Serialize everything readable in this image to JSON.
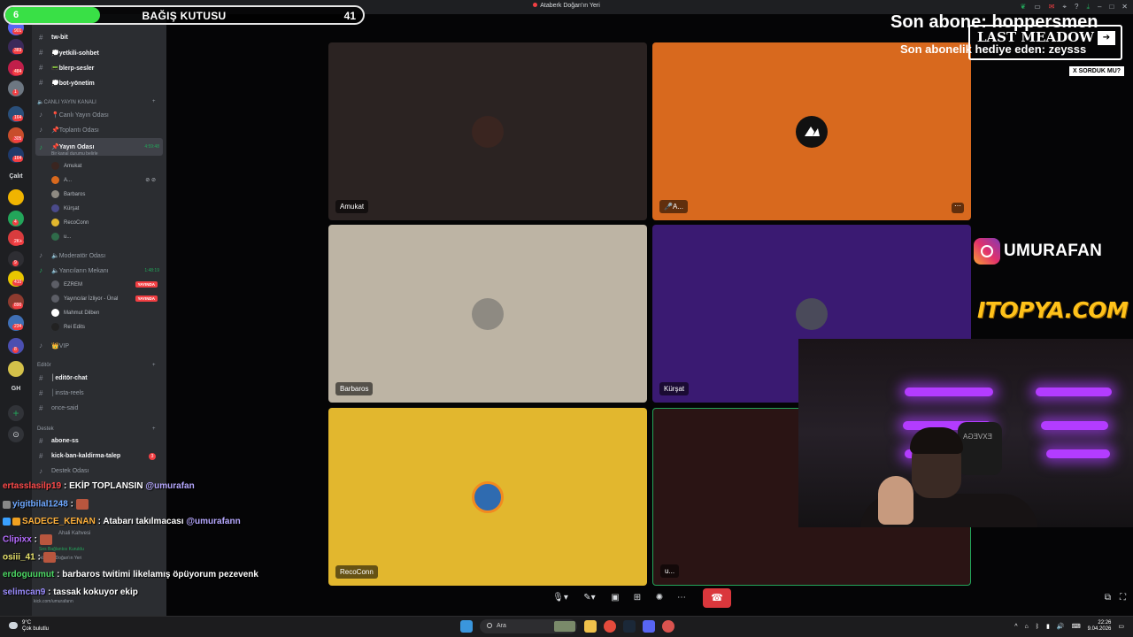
{
  "window": {
    "title": "Ataberk Doğan'ın Yeri",
    "server_header": "Ataberk Doğan'ın Yeri"
  },
  "donation": {
    "count": "6",
    "label": "BAĞIŞ KUTUSU",
    "goal": "41",
    "progress_fraction": 0.15
  },
  "rail": {
    "badges": [
      "901",
      "383",
      "484",
      "1",
      "164",
      "305",
      "164",
      "4",
      "2K+",
      "9",
      "410",
      "890",
      "234",
      "8"
    ],
    "folder_label": "Çalıt",
    "gh_label": "GH"
  },
  "sidebar": {
    "channels_top": [
      {
        "name": "tw-bit"
      },
      {
        "name": "💭yetkili-sohbet"
      },
      {
        "name": "📟blerp-sesler"
      },
      {
        "name": "💭bot-yönetim"
      }
    ],
    "cat_live": "🔈CANLI YAYIN KANALI",
    "voice_top": [
      {
        "name": "📍Canlı Yayın Odası"
      },
      {
        "name": "📌Toplantı Odası"
      }
    ],
    "active_channel": {
      "name": "📌Yayın Odası",
      "timer": "4:59:48",
      "status_hint": "Bir kanal durumu belirle"
    },
    "active_users": [
      "Amukat",
      "A...",
      "Barbaros",
      "Kürşat",
      "RecoConn",
      "u..."
    ],
    "moderator_room": "🔈Moderatör Odası",
    "publisher_room": {
      "name": "🔈Yancıların Mekanı",
      "timer": "1:48:19"
    },
    "publisher_users": [
      {
        "name": "EZREM",
        "live": "YAYINDA"
      },
      {
        "name": "Yayıncılar İzliyor - Ünal",
        "live": "YAYINDA"
      },
      {
        "name": "Mahmut Dilben",
        "live": ""
      },
      {
        "name": "Rei Edits",
        "live": ""
      }
    ],
    "vip": "👑VIP",
    "cat_editor": "Editör",
    "editor_channels": [
      {
        "name": "│editör-chat"
      },
      {
        "name": "│insta-reels"
      },
      {
        "name": "once-said"
      }
    ],
    "cat_support": "Destek",
    "support_channels": [
      {
        "name": "abone-ss",
        "badge": ""
      },
      {
        "name": "kick-ban-kaldirma-talep",
        "badge": "3"
      },
      {
        "name": "Destek Odası",
        "badge": ""
      }
    ],
    "hidden_items": [
      "Ahali Kahvesi",
      "Ses Bağlantısı Kuruldu",
      "Ataberk Doğan'ın Yeri"
    ],
    "user_panel_link": "kick.com/umurafann"
  },
  "tiles": [
    {
      "label": "Amukat",
      "bg": "#2b2322",
      "avatar_bg": "#3a2520"
    },
    {
      "label": "🎤A...",
      "bg": "#d8691e",
      "avatar_bg": "#111111"
    },
    {
      "label": "Barbaros",
      "bg": "#bdb4a4",
      "avatar_bg": "#8e8a82"
    },
    {
      "label": "Kürşat",
      "bg": "#3a1a72",
      "avatar_bg": "#4a4a5a"
    },
    {
      "label": "RecoConn",
      "bg": "#e2b72e",
      "avatar_bg": "#2f6bb0"
    },
    {
      "label": "u...",
      "bg": "#2a1414",
      "avatar_bg": "#2a1414"
    }
  ],
  "overlay": {
    "last_sub": "Son abone: hoppersmen",
    "last_gift": "Son abonelik hediye eden: zeysss",
    "last_meadow": "LAST MEADOW",
    "sorduk": "X SORDUK MU?",
    "instagram": "UMURAFAN",
    "sponsor": "ITOPYA.COM",
    "headset_text": "EXVEGA"
  },
  "chat": [
    {
      "user": "ertasslasilp19",
      "color": "#ff4a4a",
      "text": "EKİP TOPLANSIN",
      "mention": "@umurafan",
      "emote": false
    },
    {
      "user": "yigitbilal1248",
      "color": "#6ea8ff",
      "text": "",
      "mention": "",
      "emote": true
    },
    {
      "user": "SADECE_KENAN",
      "color": "#ffb13b",
      "text": "Atabarı takılmacası",
      "mention": "@umurafann",
      "emote": false
    },
    {
      "user": "Clipixx",
      "color": "#b66cff",
      "text": "",
      "mention": "",
      "emote": true
    },
    {
      "user": "osiii_41",
      "color": "#e8e36b",
      "text": "",
      "mention": "",
      "emote": true
    },
    {
      "user": "erdoguumut",
      "color": "#4cd964",
      "text": "barbaros twitimi likelamış öpüyorum pezevenk",
      "mention": "",
      "emote": false
    },
    {
      "user": "selimcan9",
      "color": "#9b8cff",
      "text": "tassak kokuyor ekip",
      "mention": "",
      "emote": false
    }
  ],
  "taskbar": {
    "weather_temp": "9°C",
    "weather_desc": "Çok bulutlu",
    "search_placeholder": "Ara",
    "time": "22:26",
    "date": "9.04.2026"
  }
}
